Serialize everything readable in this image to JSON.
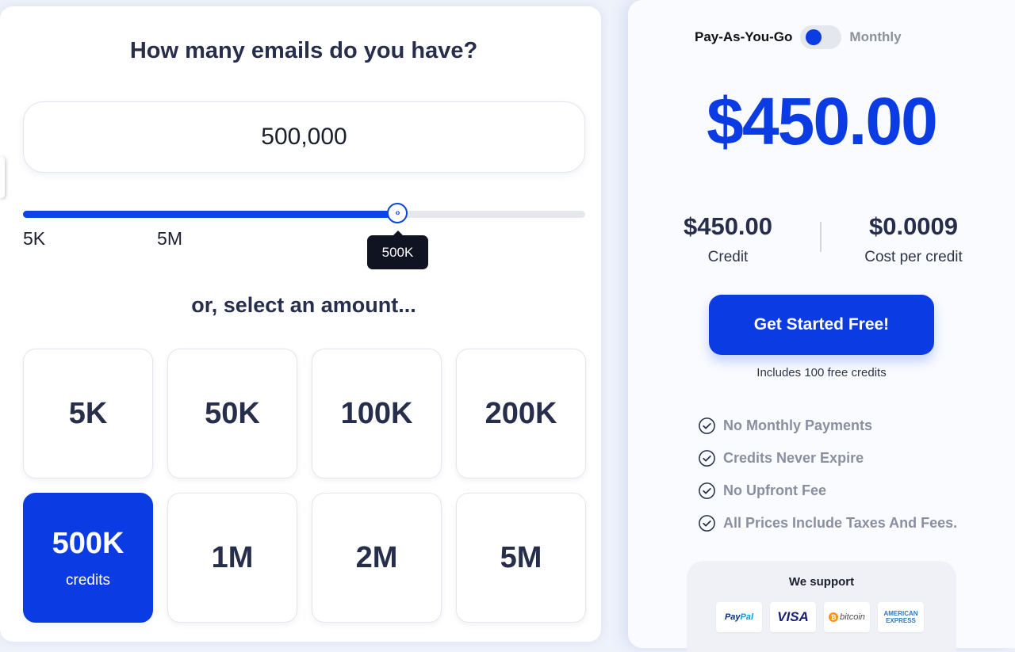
{
  "calculator": {
    "question": "How many emails do you have?",
    "amount_value": "500,000",
    "slider": {
      "min_label": "5K",
      "max_label": "5M",
      "tooltip": "500K",
      "thumb_symbol": "‹›",
      "fill_fraction": 0.667
    },
    "select_heading": "or, select an amount...",
    "options": [
      {
        "label": "5K",
        "selected": false
      },
      {
        "label": "50K",
        "selected": false
      },
      {
        "label": "100K",
        "selected": false
      },
      {
        "label": "200K",
        "selected": false
      },
      {
        "label": "500K",
        "sublabel": "credits",
        "selected": true
      },
      {
        "label": "1M",
        "selected": false
      },
      {
        "label": "2M",
        "selected": false
      },
      {
        "label": "5M",
        "selected": false
      }
    ]
  },
  "pricing": {
    "toggle_left": "Pay-As-You-Go",
    "toggle_right": "Monthly",
    "toggle_state": "Pay-As-You-Go",
    "big_price": "$450.00",
    "credit_value": "$450.00",
    "credit_label": "Credit",
    "cost_value": "$0.0009",
    "cost_label": "Cost per credit",
    "cta_label": "Get Started Free!",
    "cta_note": "Includes 100 free credits",
    "features": [
      "No Monthly Payments",
      "Credits Never Expire",
      "No Upfront Fee",
      "All Prices Include Taxes And Fees."
    ],
    "support_title": "We support",
    "payments": {
      "paypal": {
        "p1": "Pay",
        "p2": "Pal"
      },
      "visa": "VISA",
      "bitcoin": {
        "symbol": "₿",
        "text": "bitcoin"
      },
      "amex": {
        "line1": "AMERICAN",
        "line2": "EXPRESS"
      }
    }
  },
  "colors": {
    "accent": "#0b3be3",
    "heading": "#262e4b",
    "feature_text": "#8a8fa0"
  }
}
